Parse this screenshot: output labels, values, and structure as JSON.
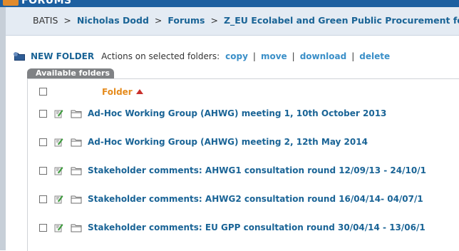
{
  "header": {
    "title": "FORUMS"
  },
  "breadcrumb": {
    "root": "BATIS",
    "separator": ">",
    "items": [
      "Nicholas Dodd",
      "Forums",
      "Z_EU Ecolabel and Green Public Procurement for"
    ]
  },
  "toolbar": {
    "new_folder_label": "NEW FOLDER",
    "actions_label": "Actions on selected folders:",
    "actions": [
      "copy",
      "move",
      "download",
      "delete"
    ]
  },
  "panel": {
    "tab_label": "Available folders",
    "column_header": "Folder",
    "sort": "ascending"
  },
  "folders": [
    "Ad-Hoc Working Group (AHWG) meeting 1, 10th October 2013",
    "Ad-Hoc Working Group (AHWG) meeting 2, 12th May 2014",
    "Stakeholder comments: AHWG1 consultation round 12/09/13 - 24/10/1",
    "Stakeholder comments: AHWG2 consultation round 16/04/14- 04/07/1",
    "Stakeholder comments: EU GPP consultation round 30/04/14 - 13/06/1"
  ],
  "colors": {
    "link": "#1a6496",
    "action_link": "#3a8fc8",
    "header_accent": "#e58b1d",
    "topbar": "#1d5fa0"
  }
}
